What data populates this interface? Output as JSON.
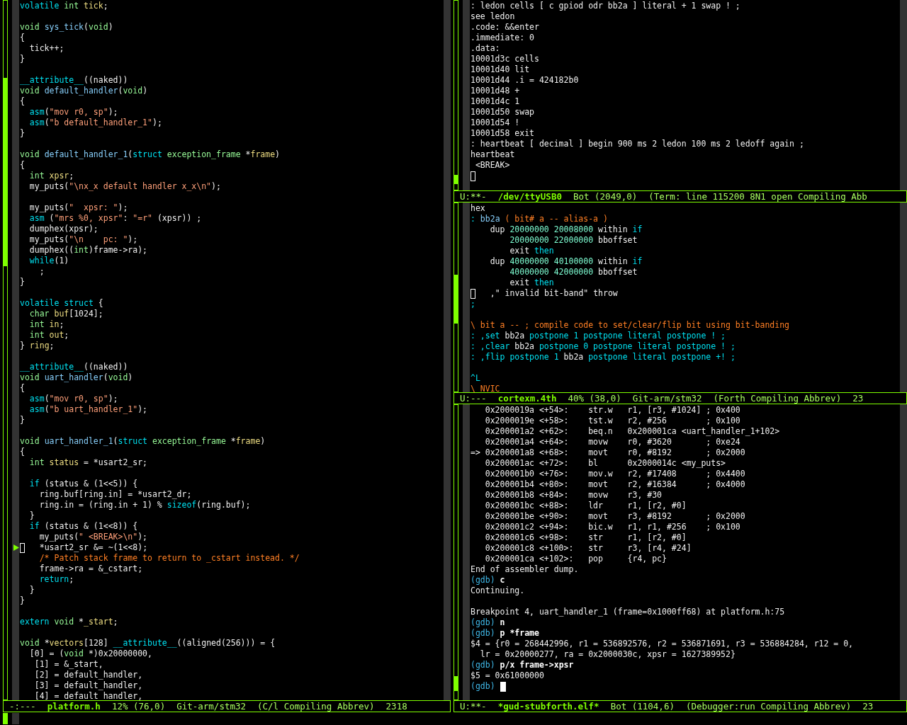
{
  "left_window": {
    "lines": [
      {
        "kind": "text",
        "segments": [
          {
            "text": "volatile ",
            "kind": "keyword"
          },
          {
            "text": "int ",
            "kind": "type"
          },
          {
            "text": "tick",
            "kind": "variable"
          },
          {
            "text": ";",
            "kind": "plain"
          }
        ]
      },
      {
        "kind": "blank"
      },
      {
        "kind": "text",
        "segments": [
          {
            "text": "void ",
            "kind": "type"
          },
          {
            "text": "sys_tick",
            "kind": "function"
          },
          {
            "text": "(",
            "kind": "plain"
          },
          {
            "text": "void",
            "kind": "type"
          },
          {
            "text": ")",
            "kind": "plain"
          }
        ]
      },
      {
        "kind": "text",
        "segments": [
          {
            "text": "{",
            "kind": "plain"
          }
        ]
      },
      {
        "kind": "text",
        "segments": [
          {
            "text": "  tick++;",
            "kind": "plain"
          }
        ]
      },
      {
        "kind": "text",
        "segments": [
          {
            "text": "}",
            "kind": "plain"
          }
        ]
      },
      {
        "kind": "blank"
      },
      {
        "kind": "text",
        "segments": [
          {
            "text": "__attribute__",
            "kind": "keyword"
          },
          {
            "text": "((naked))",
            "kind": "plain"
          }
        ]
      },
      {
        "kind": "text",
        "segments": [
          {
            "text": "void ",
            "kind": "type"
          },
          {
            "text": "default_handler",
            "kind": "function"
          },
          {
            "text": "(",
            "kind": "plain"
          },
          {
            "text": "void",
            "kind": "type"
          },
          {
            "text": ")",
            "kind": "plain"
          }
        ]
      },
      {
        "kind": "text",
        "segments": [
          {
            "text": "{",
            "kind": "plain"
          }
        ]
      },
      {
        "kind": "text",
        "segments": [
          {
            "text": "  asm",
            "kind": "keyword"
          },
          {
            "text": "(",
            "kind": "plain"
          },
          {
            "text": "\"mov r0, sp\"",
            "kind": "string"
          },
          {
            "text": ");",
            "kind": "plain"
          }
        ]
      },
      {
        "kind": "text",
        "segments": [
          {
            "text": "  asm",
            "kind": "keyword"
          },
          {
            "text": "(",
            "kind": "plain"
          },
          {
            "text": "\"b default_handler_1\"",
            "kind": "string"
          },
          {
            "text": ");",
            "kind": "plain"
          }
        ]
      },
      {
        "kind": "text",
        "segments": [
          {
            "text": "}",
            "kind": "plain"
          }
        ]
      },
      {
        "kind": "blank"
      },
      {
        "kind": "text",
        "segments": [
          {
            "text": "void ",
            "kind": "type"
          },
          {
            "text": "default_handler_1",
            "kind": "function"
          },
          {
            "text": "(",
            "kind": "plain"
          },
          {
            "text": "struct ",
            "kind": "keyword"
          },
          {
            "text": "exception_frame",
            "kind": "type"
          },
          {
            "text": " *",
            "kind": "plain"
          },
          {
            "text": "frame",
            "kind": "variable"
          },
          {
            "text": ")",
            "kind": "plain"
          }
        ]
      },
      {
        "kind": "text",
        "segments": [
          {
            "text": "{",
            "kind": "plain"
          }
        ]
      },
      {
        "kind": "text",
        "segments": [
          {
            "text": "  int ",
            "kind": "type"
          },
          {
            "text": "xpsr",
            "kind": "variable"
          },
          {
            "text": ";",
            "kind": "plain"
          }
        ]
      },
      {
        "kind": "text",
        "segments": [
          {
            "text": "  my_puts(",
            "kind": "plain"
          },
          {
            "text": "\"\\nx_x default handler x_x\\n\"",
            "kind": "string"
          },
          {
            "text": ");",
            "kind": "plain"
          }
        ]
      },
      {
        "kind": "blank"
      },
      {
        "kind": "text",
        "segments": [
          {
            "text": "  my_puts(",
            "kind": "plain"
          },
          {
            "text": "\"  xpsr: \"",
            "kind": "string"
          },
          {
            "text": ");",
            "kind": "plain"
          }
        ]
      },
      {
        "kind": "text",
        "segments": [
          {
            "text": "  asm",
            "kind": "keyword"
          },
          {
            "text": " (",
            "kind": "plain"
          },
          {
            "text": "\"mrs %0, xpsr\"",
            "kind": "string"
          },
          {
            "text": ": ",
            "kind": "plain"
          },
          {
            "text": "\"=r\"",
            "kind": "string"
          },
          {
            "text": " (xpsr)) ;",
            "kind": "plain"
          }
        ]
      },
      {
        "kind": "text",
        "segments": [
          {
            "text": "  dumphex(xpsr);",
            "kind": "plain"
          }
        ]
      },
      {
        "kind": "text",
        "segments": [
          {
            "text": "  my_puts(",
            "kind": "plain"
          },
          {
            "text": "\"\\n    pc: \"",
            "kind": "string"
          },
          {
            "text": ");",
            "kind": "plain"
          }
        ]
      },
      {
        "kind": "text",
        "segments": [
          {
            "text": "  dumphex((",
            "kind": "plain"
          },
          {
            "text": "int",
            "kind": "type"
          },
          {
            "text": ")frame->ra);",
            "kind": "plain"
          }
        ]
      },
      {
        "kind": "text",
        "segments": [
          {
            "text": "  while",
            "kind": "keyword"
          },
          {
            "text": "(1)",
            "kind": "plain"
          }
        ]
      },
      {
        "kind": "text",
        "segments": [
          {
            "text": "    ;",
            "kind": "plain"
          }
        ]
      },
      {
        "kind": "text",
        "segments": [
          {
            "text": "}",
            "kind": "plain"
          }
        ]
      },
      {
        "kind": "blank"
      },
      {
        "kind": "text",
        "segments": [
          {
            "text": "volatile struct",
            "kind": "keyword"
          },
          {
            "text": " {",
            "kind": "plain"
          }
        ]
      },
      {
        "kind": "text",
        "segments": [
          {
            "text": "  char ",
            "kind": "type"
          },
          {
            "text": "buf",
            "kind": "variable"
          },
          {
            "text": "[1024];",
            "kind": "plain"
          }
        ]
      },
      {
        "kind": "text",
        "segments": [
          {
            "text": "  int ",
            "kind": "type"
          },
          {
            "text": "in",
            "kind": "variable"
          },
          {
            "text": ";",
            "kind": "plain"
          }
        ]
      },
      {
        "kind": "text",
        "segments": [
          {
            "text": "  int ",
            "kind": "type"
          },
          {
            "text": "out",
            "kind": "variable"
          },
          {
            "text": ";",
            "kind": "plain"
          }
        ]
      },
      {
        "kind": "text",
        "segments": [
          {
            "text": "} ",
            "kind": "plain"
          },
          {
            "text": "ring",
            "kind": "variable"
          },
          {
            "text": ";",
            "kind": "plain"
          }
        ]
      },
      {
        "kind": "blank"
      },
      {
        "kind": "text",
        "segments": [
          {
            "text": "__attribute__",
            "kind": "keyword"
          },
          {
            "text": "((naked))",
            "kind": "plain"
          }
        ]
      },
      {
        "kind": "text",
        "segments": [
          {
            "text": "void ",
            "kind": "type"
          },
          {
            "text": "uart_handler",
            "kind": "function"
          },
          {
            "text": "(",
            "kind": "plain"
          },
          {
            "text": "void",
            "kind": "type"
          },
          {
            "text": ")",
            "kind": "plain"
          }
        ]
      },
      {
        "kind": "text",
        "segments": [
          {
            "text": "{",
            "kind": "plain"
          }
        ]
      },
      {
        "kind": "text",
        "segments": [
          {
            "text": "  asm",
            "kind": "keyword"
          },
          {
            "text": "(",
            "kind": "plain"
          },
          {
            "text": "\"mov r0, sp\"",
            "kind": "string"
          },
          {
            "text": ");",
            "kind": "plain"
          }
        ]
      },
      {
        "kind": "text",
        "segments": [
          {
            "text": "  asm",
            "kind": "keyword"
          },
          {
            "text": "(",
            "kind": "plain"
          },
          {
            "text": "\"b uart_handler_1\"",
            "kind": "string"
          },
          {
            "text": ");",
            "kind": "plain"
          }
        ]
      },
      {
        "kind": "text",
        "segments": [
          {
            "text": "}",
            "kind": "plain"
          }
        ]
      },
      {
        "kind": "blank"
      },
      {
        "kind": "text",
        "segments": [
          {
            "text": "void ",
            "kind": "type"
          },
          {
            "text": "uart_handler_1",
            "kind": "function"
          },
          {
            "text": "(",
            "kind": "plain"
          },
          {
            "text": "struct ",
            "kind": "keyword"
          },
          {
            "text": "exception_frame",
            "kind": "type"
          },
          {
            "text": " *",
            "kind": "plain"
          },
          {
            "text": "frame",
            "kind": "variable"
          },
          {
            "text": ")",
            "kind": "plain"
          }
        ]
      },
      {
        "kind": "text",
        "segments": [
          {
            "text": "{",
            "kind": "plain"
          }
        ]
      },
      {
        "kind": "text",
        "segments": [
          {
            "text": "  int ",
            "kind": "type"
          },
          {
            "text": "status",
            "kind": "variable"
          },
          {
            "text": " = *usart2_sr;",
            "kind": "plain"
          }
        ]
      },
      {
        "kind": "blank"
      },
      {
        "kind": "text",
        "segments": [
          {
            "text": "  if",
            "kind": "keyword"
          },
          {
            "text": " (status & (1<<5)) {",
            "kind": "plain"
          }
        ]
      },
      {
        "kind": "text",
        "segments": [
          {
            "text": "    ring.buf[ring.in] = *usart2_dr;",
            "kind": "plain"
          }
        ]
      },
      {
        "kind": "text",
        "segments": [
          {
            "text": "    ring.in = (ring.in + 1) % ",
            "kind": "plain"
          },
          {
            "text": "sizeof",
            "kind": "keyword"
          },
          {
            "text": "(ring.buf);",
            "kind": "plain"
          }
        ]
      },
      {
        "kind": "text",
        "segments": [
          {
            "text": "  }",
            "kind": "plain"
          }
        ]
      },
      {
        "kind": "text",
        "segments": [
          {
            "text": "  if",
            "kind": "keyword"
          },
          {
            "text": " (status & (1<<8)) {",
            "kind": "plain"
          }
        ]
      },
      {
        "kind": "text",
        "segments": [
          {
            "text": "    my_puts(",
            "kind": "plain"
          },
          {
            "text": "\" <BREAK>\\n\"",
            "kind": "string"
          },
          {
            "text": ");",
            "kind": "plain"
          }
        ]
      },
      {
        "kind": "text",
        "hollow_cursor": true,
        "arrow": true,
        "segments": [
          {
            "text": "   *usart2_sr &= ~(1<<8);",
            "kind": "plain"
          }
        ]
      },
      {
        "kind": "text",
        "segments": [
          {
            "text": "    /* Patch stack frame to return to _cstart instead. */",
            "kind": "comment"
          }
        ]
      },
      {
        "kind": "text",
        "segments": [
          {
            "text": "    frame->ra = &_cstart;",
            "kind": "plain"
          }
        ]
      },
      {
        "kind": "text",
        "segments": [
          {
            "text": "    return",
            "kind": "keyword"
          },
          {
            "text": ";",
            "kind": "plain"
          }
        ]
      },
      {
        "kind": "text",
        "segments": [
          {
            "text": "  }",
            "kind": "plain"
          }
        ]
      },
      {
        "kind": "text",
        "segments": [
          {
            "text": "}",
            "kind": "plain"
          }
        ]
      },
      {
        "kind": "blank"
      },
      {
        "kind": "text",
        "segments": [
          {
            "text": "extern ",
            "kind": "keyword"
          },
          {
            "text": "void",
            "kind": "type"
          },
          {
            "text": " *",
            "kind": "plain"
          },
          {
            "text": "_start",
            "kind": "variable"
          },
          {
            "text": ";",
            "kind": "plain"
          }
        ]
      },
      {
        "kind": "blank"
      },
      {
        "kind": "text",
        "segments": [
          {
            "text": "void",
            "kind": "type"
          },
          {
            "text": " *",
            "kind": "plain"
          },
          {
            "text": "vectors",
            "kind": "variable"
          },
          {
            "text": "[128] ",
            "kind": "plain"
          },
          {
            "text": "__attribute__",
            "kind": "keyword"
          },
          {
            "text": "((aligned(256))) = {",
            "kind": "plain"
          }
        ]
      },
      {
        "kind": "text",
        "segments": [
          {
            "text": "  [0] = (",
            "kind": "plain"
          },
          {
            "text": "void",
            "kind": "type"
          },
          {
            "text": " *)0x20000000,",
            "kind": "plain"
          }
        ]
      },
      {
        "kind": "text",
        "segments": [
          {
            "text": "   [1] = &_start,",
            "kind": "plain"
          }
        ]
      },
      {
        "kind": "text",
        "segments": [
          {
            "text": "   [2] = default_handler,",
            "kind": "plain"
          }
        ]
      },
      {
        "kind": "text",
        "segments": [
          {
            "text": "   [3] = default_handler,",
            "kind": "plain"
          }
        ]
      },
      {
        "kind": "text",
        "segments": [
          {
            "text": "   [4] = default_handler,",
            "kind": "plain"
          }
        ]
      }
    ],
    "mode_line": {
      "status": "-:---",
      "buffer": "platform.h",
      "position": "12% (76,0)",
      "vc": "Git-arm/stm32",
      "modes": "(C/l Compiling Abbrev)",
      "extra": "2318"
    }
  },
  "right_windows": [
    {
      "lines": [
        {
          "kind": "text",
          "segments": [
            {
              "text": ": ledon cells [ c gpiod odr bb2a ] literal + 1 swap ! ;",
              "kind": "plain"
            }
          ]
        },
        {
          "kind": "text",
          "segments": [
            {
              "text": "see ledon",
              "kind": "plain"
            }
          ]
        },
        {
          "kind": "text",
          "segments": [
            {
              "text": ".code: &&enter",
              "kind": "plain"
            }
          ]
        },
        {
          "kind": "text",
          "segments": [
            {
              "text": ".immediate: 0",
              "kind": "plain"
            }
          ]
        },
        {
          "kind": "text",
          "segments": [
            {
              "text": ".data:",
              "kind": "plain"
            }
          ]
        },
        {
          "kind": "text",
          "segments": [
            {
              "text": "10001d3c cells",
              "kind": "plain"
            }
          ]
        },
        {
          "kind": "text",
          "segments": [
            {
              "text": "10001d40 lit",
              "kind": "plain"
            }
          ]
        },
        {
          "kind": "text",
          "segments": [
            {
              "text": "10001d44 .i = 424182b0",
              "kind": "plain"
            }
          ]
        },
        {
          "kind": "text",
          "segments": [
            {
              "text": "10001d48 +",
              "kind": "plain"
            }
          ]
        },
        {
          "kind": "text",
          "segments": [
            {
              "text": "10001d4c 1",
              "kind": "plain"
            }
          ]
        },
        {
          "kind": "text",
          "segments": [
            {
              "text": "10001d50 swap",
              "kind": "plain"
            }
          ]
        },
        {
          "kind": "text",
          "segments": [
            {
              "text": "10001d54 !",
              "kind": "plain"
            }
          ]
        },
        {
          "kind": "text",
          "segments": [
            {
              "text": "10001d58 exit",
              "kind": "plain"
            }
          ]
        },
        {
          "kind": "text",
          "segments": [
            {
              "text": ": heartbeat [ decimal ] begin 900 ms 2 ledon 100 ms 2 ledoff again ;",
              "kind": "plain"
            }
          ]
        },
        {
          "kind": "text",
          "segments": [
            {
              "text": "heartbeat",
              "kind": "plain"
            }
          ]
        },
        {
          "kind": "text",
          "segments": [
            {
              "text": " <BREAK>",
              "kind": "plain"
            }
          ]
        },
        {
          "kind": "text",
          "hollow_cursor": true
        }
      ],
      "mode_line": {
        "status": "U:**-",
        "buffer": "/dev/ttyUSB0",
        "position": "Bot (2049,0)",
        "modes": "(Term: line 115200 8N1 open Compiling Abb"
      }
    },
    {
      "lines": [
        {
          "kind": "text",
          "segments": [
            {
              "text": "hex",
              "kind": "plain"
            }
          ]
        },
        {
          "kind": "text",
          "segments": [
            {
              "text": ": ",
              "kind": "keyword"
            },
            {
              "text": "bb2a ",
              "kind": "function"
            },
            {
              "text": "( bit# a -- alias-a )",
              "kind": "comment"
            }
          ]
        },
        {
          "kind": "text",
          "segments": [
            {
              "text": "    dup ",
              "kind": "plain"
            },
            {
              "text": "20000000 20008000",
              "kind": "number"
            },
            {
              "text": " within ",
              "kind": "plain"
            },
            {
              "text": "if",
              "kind": "keyword"
            }
          ]
        },
        {
          "kind": "text",
          "segments": [
            {
              "text": "        20000000 22000000",
              "kind": "number"
            },
            {
              "text": " bboffset",
              "kind": "plain"
            }
          ]
        },
        {
          "kind": "text",
          "segments": [
            {
              "text": "        exit ",
              "kind": "plain"
            },
            {
              "text": "then",
              "kind": "keyword"
            }
          ]
        },
        {
          "kind": "text",
          "segments": [
            {
              "text": "    dup ",
              "kind": "plain"
            },
            {
              "text": "40000000 40100000",
              "kind": "number"
            },
            {
              "text": " within ",
              "kind": "plain"
            },
            {
              "text": "if",
              "kind": "keyword"
            }
          ]
        },
        {
          "kind": "text",
          "segments": [
            {
              "text": "        40000000 42000000",
              "kind": "number"
            },
            {
              "text": " bboffset",
              "kind": "plain"
            }
          ]
        },
        {
          "kind": "text",
          "segments": [
            {
              "text": "        exit ",
              "kind": "plain"
            },
            {
              "text": "then",
              "kind": "keyword"
            }
          ]
        },
        {
          "kind": "text",
          "hollow_cursor": true,
          "segments": [
            {
              "text": "   ,\" invalid bit-band\" throw",
              "kind": "plain"
            }
          ]
        },
        {
          "kind": "text",
          "segments": [
            {
              "text": ";",
              "kind": "keyword"
            }
          ]
        },
        {
          "kind": "blank"
        },
        {
          "kind": "text",
          "segments": [
            {
              "text": "\\ bit a -- ; compile code to set/clear/flip bit using bit-banding",
              "kind": "comment"
            }
          ]
        },
        {
          "kind": "text",
          "segments": [
            {
              "text": ": ,set",
              "kind": "keyword"
            },
            {
              "text": " bb2a ",
              "kind": "plain"
            },
            {
              "text": "postpone 1 postpone literal postpone ! ;",
              "kind": "keyword"
            }
          ]
        },
        {
          "kind": "text",
          "segments": [
            {
              "text": ": ,clear",
              "kind": "keyword"
            },
            {
              "text": " bb2a ",
              "kind": "plain"
            },
            {
              "text": "postpone 0 postpone literal postpone ! ;",
              "kind": "keyword"
            }
          ]
        },
        {
          "kind": "text",
          "segments": [
            {
              "text": ": ,flip postpone 1",
              "kind": "keyword"
            },
            {
              "text": " bb2a ",
              "kind": "plain"
            },
            {
              "text": "postpone literal postpone +! ;",
              "kind": "keyword"
            }
          ]
        },
        {
          "kind": "blank"
        },
        {
          "kind": "text",
          "segments": [
            {
              "text": "^L",
              "kind": "keyword"
            }
          ]
        },
        {
          "kind": "text",
          "segments": [
            {
              "text": "\\ NVIC",
              "kind": "comment"
            }
          ]
        }
      ],
      "mode_line": {
        "status": "U:---",
        "buffer": "cortexm.4th",
        "position": "40% (38,0)",
        "vc": "Git-arm/stm32",
        "modes": "(Forth Compiling Abbrev)",
        "extra": "23"
      }
    },
    {
      "lines": [
        {
          "kind": "text",
          "segments": [
            {
              "text": "   0x2000019a <+54>:    str.w   r1, [r3, #1024] ; 0x400",
              "kind": "plain"
            }
          ]
        },
        {
          "kind": "text",
          "segments": [
            {
              "text": "   0x2000019e <+58>:    tst.w   r2, #256        ; 0x100",
              "kind": "plain"
            }
          ]
        },
        {
          "kind": "text",
          "segments": [
            {
              "text": "   0x200001a2 <+62>:    beq.n   0x200001ca <uart_handler_1+102>",
              "kind": "plain"
            }
          ]
        },
        {
          "kind": "text",
          "segments": [
            {
              "text": "   0x200001a4 <+64>:    movw    r0, #3620       ; 0xe24",
              "kind": "plain"
            }
          ]
        },
        {
          "kind": "text",
          "segments": [
            {
              "text": "=> 0x200001a8 <+68>:    movt    r0, #8192       ; 0x2000",
              "kind": "plain"
            }
          ]
        },
        {
          "kind": "text",
          "segments": [
            {
              "text": "   0x200001ac <+72>:    bl      0x2000014c <my_puts>",
              "kind": "plain"
            }
          ]
        },
        {
          "kind": "text",
          "segments": [
            {
              "text": "   0x200001b0 <+76>:    mov.w   r2, #17408      ; 0x4400",
              "kind": "plain"
            }
          ]
        },
        {
          "kind": "text",
          "segments": [
            {
              "text": "   0x200001b4 <+80>:    movt    r2, #16384      ; 0x4000",
              "kind": "plain"
            }
          ]
        },
        {
          "kind": "text",
          "segments": [
            {
              "text": "   0x200001b8 <+84>:    movw    r3, #30",
              "kind": "plain"
            }
          ]
        },
        {
          "kind": "text",
          "segments": [
            {
              "text": "   0x200001bc <+88>:    ldr     r1, [r2, #0]",
              "kind": "plain"
            }
          ]
        },
        {
          "kind": "text",
          "segments": [
            {
              "text": "   0x200001be <+90>:    movt    r3, #8192       ; 0x2000",
              "kind": "plain"
            }
          ]
        },
        {
          "kind": "text",
          "segments": [
            {
              "text": "   0x200001c2 <+94>:    bic.w   r1, r1, #256    ; 0x100",
              "kind": "plain"
            }
          ]
        },
        {
          "kind": "text",
          "segments": [
            {
              "text": "   0x200001c6 <+98>:    str     r1, [r2, #0]",
              "kind": "plain"
            }
          ]
        },
        {
          "kind": "text",
          "segments": [
            {
              "text": "   0x200001c8 <+100>:   str     r3, [r4, #24]",
              "kind": "plain"
            }
          ]
        },
        {
          "kind": "text",
          "segments": [
            {
              "text": "   0x200001ca <+102>:   pop     {r4, pc}",
              "kind": "plain"
            }
          ]
        },
        {
          "kind": "text",
          "segments": [
            {
              "text": "End of assembler dump.",
              "kind": "plain"
            }
          ]
        },
        {
          "kind": "text",
          "segments": [
            {
              "text": "(gdb) ",
              "kind": "prompt"
            },
            {
              "text": "c",
              "kind": "bold"
            }
          ]
        },
        {
          "kind": "text",
          "segments": [
            {
              "text": "Continuing.",
              "kind": "plain"
            }
          ]
        },
        {
          "kind": "blank"
        },
        {
          "kind": "text",
          "segments": [
            {
              "text": "Breakpoint 4, uart_handler_1 (frame=0x1000ff68) at platform.h:75",
              "kind": "plain"
            }
          ]
        },
        {
          "kind": "text",
          "segments": [
            {
              "text": "(gdb) ",
              "kind": "prompt"
            },
            {
              "text": "n",
              "kind": "bold"
            }
          ]
        },
        {
          "kind": "text",
          "segments": [
            {
              "text": "(gdb) ",
              "kind": "prompt"
            },
            {
              "text": "p *frame",
              "kind": "bold"
            }
          ]
        },
        {
          "kind": "text",
          "segments": [
            {
              "text": "$4 = {r0 = 268442996, r1 = 536892576, r2 = 536871691, r3 = 536884284, r12 = 0,",
              "kind": "plain"
            }
          ]
        },
        {
          "kind": "text",
          "segments": [
            {
              "text": "  lr = 0x20000277, ra = 0x2000030c, xpsr = 1627389952}",
              "kind": "plain"
            }
          ]
        },
        {
          "kind": "text",
          "segments": [
            {
              "text": "(gdb) ",
              "kind": "prompt"
            },
            {
              "text": "p/x frame->xpsr",
              "kind": "bold"
            }
          ]
        },
        {
          "kind": "text",
          "segments": [
            {
              "text": "$5 = 0x61000000",
              "kind": "plain"
            }
          ]
        },
        {
          "kind": "text",
          "block_cursor": true,
          "segments": [
            {
              "text": "(gdb) ",
              "kind": "prompt"
            }
          ]
        }
      ],
      "mode_line": {
        "status": "U:**-",
        "buffer": "*gud-stubforth.elf*",
        "position": "Bot (1104,6)",
        "modes": "(Debugger:run Compiling Abbrev)",
        "extra": "23"
      }
    }
  ]
}
